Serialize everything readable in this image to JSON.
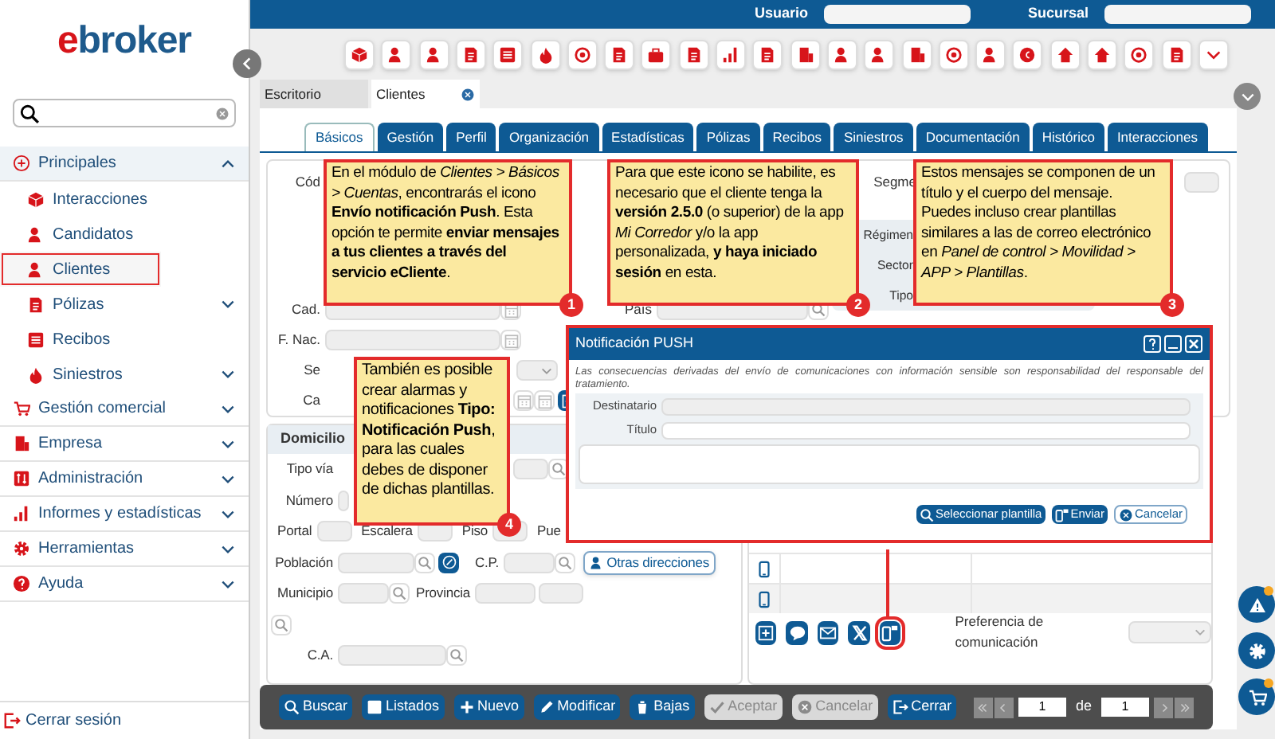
{
  "top_bar": {
    "user_label": "Usuario",
    "branch_label": "Sucursal"
  },
  "sidebar": {
    "logo": "ebroker",
    "menu": [
      {
        "label": "Principales",
        "expanded": true,
        "children": [
          {
            "label": "Interacciones",
            "selected": false
          },
          {
            "label": "Candidatos",
            "selected": false
          },
          {
            "label": "Clientes",
            "selected": true
          },
          {
            "label": "Pólizas",
            "selected": false,
            "expanded": false
          },
          {
            "label": "Recibos",
            "selected": false
          },
          {
            "label": "Siniestros",
            "selected": false,
            "expanded": false
          }
        ]
      },
      {
        "label": "Gestión comercial",
        "expanded": false
      },
      {
        "label": "Empresa",
        "expanded": false
      },
      {
        "label": "Administración",
        "expanded": false
      },
      {
        "label": "Informes y estadísticas",
        "expanded": false
      },
      {
        "label": "Herramientas",
        "expanded": false
      },
      {
        "label": "Ayuda",
        "expanded": false
      }
    ],
    "logout": "Cerrar sesión"
  },
  "document_tabs": [
    {
      "label": "Escritorio",
      "selected": false
    },
    {
      "label": "Clientes",
      "selected": true
    }
  ],
  "tabs": [
    {
      "label": "Básicos",
      "selected": true
    },
    {
      "label": "Gestión",
      "selected": false
    },
    {
      "label": "Perfil",
      "selected": false
    },
    {
      "label": "Organización",
      "selected": false
    },
    {
      "label": "Estadísticas",
      "selected": false
    },
    {
      "label": "Pólizas",
      "selected": false
    },
    {
      "label": "Recibos",
      "selected": false
    },
    {
      "label": "Siniestros",
      "selected": false
    },
    {
      "label": "Documentación",
      "selected": false
    },
    {
      "label": "Histórico",
      "selected": false
    },
    {
      "label": "Interacciones",
      "selected": false
    }
  ],
  "client_form": {
    "left_rows": [
      {
        "label": "Cód",
        "kind": "text"
      },
      {
        "label": "Cad.",
        "kind": "date"
      },
      {
        "label": "F. Nac.",
        "kind": "date"
      },
      {
        "label": "Se",
        "kind": "select"
      },
      {
        "label": "Ca",
        "kind": "date_add"
      }
    ],
    "middle_rows": [
      {
        "label": "País",
        "kind": "search"
      }
    ],
    "segment_label": "Segme",
    "panel_rows": [
      {
        "label": "Régimen"
      },
      {
        "label": "Sector"
      },
      {
        "label": "Tipo"
      }
    ]
  },
  "address": {
    "title": "Domicilio",
    "rows": [
      [
        {
          "label": "Tipo vía",
          "kind": "search_far"
        }
      ],
      [
        {
          "label": "Número",
          "kind": "stub"
        }
      ],
      [
        {
          "label": "Portal",
          "kind": "short"
        },
        {
          "label": "Escalera",
          "kind": "short"
        },
        {
          "label": "Piso",
          "kind": "short"
        },
        {
          "label": "Pue",
          "kind": "none"
        }
      ],
      [
        {
          "label": "Población",
          "kind": "locate"
        },
        {
          "label": "C.P.",
          "kind": "search_small"
        }
      ],
      [
        {
          "label": "Municipio",
          "kind": "search_small"
        },
        {
          "label": "Provincia",
          "kind": "pair"
        }
      ],
      [
        {
          "kind": "search_only"
        }
      ],
      [
        {
          "label": "C.A.",
          "kind": "search_mid"
        }
      ]
    ],
    "other_button": "Otras direcciones"
  },
  "contacts": {
    "preference_label": "Preferencia de comunicación"
  },
  "dialog": {
    "title": "Notificación PUSH",
    "notice": "Las consecuencias derivadas del envío de comunicaciones con información sensible son responsabilidad del responsable del tratamiento.",
    "recipient_label": "Destinatario",
    "title_label": "Título",
    "buttons": [
      {
        "label": "Seleccionar plantilla",
        "kind": "template"
      },
      {
        "label": "Enviar",
        "kind": "send"
      },
      {
        "label": "Cancelar",
        "kind": "cancel"
      }
    ]
  },
  "bottom_bar": {
    "buttons": [
      {
        "label": "Buscar",
        "disabled": false
      },
      {
        "label": "Listados",
        "disabled": false
      },
      {
        "label": "Nuevo",
        "disabled": false
      },
      {
        "label": "Modificar",
        "disabled": false
      },
      {
        "label": "Bajas",
        "disabled": false
      },
      {
        "label": "Aceptar",
        "disabled": true
      },
      {
        "label": "Cancelar",
        "disabled": true
      },
      {
        "label": "Cerrar",
        "disabled": false
      }
    ],
    "page": "1",
    "of_label": "de",
    "total": "1"
  },
  "callouts": [
    {
      "number": "1",
      "text": "En el módulo de *Clientes > Básicos > Cuentas*, encontrarás el icono **Envío notificación Push**. Esta opción te permite **enviar mensajes a tus clientes a través del servicio eCliente**."
    },
    {
      "number": "2",
      "text": "Para que este icono se habilite, es necesario que el cliente tenga la **versión 2.5.0** (o superior) de la app *Mi Corredor* y/o la app personalizada, **y haya iniciado sesión** en esta."
    },
    {
      "number": "3",
      "text": "Estos mensajes se componen de un título y el cuerpo del mensaje. Puedes incluso crear plantillas similares a las de correo electrónico en *Panel de control > Movilidad > APP > Plantillas*."
    },
    {
      "number": "4",
      "text": "También es posible crear alarmas y notificaciones **Tipo: Notificación Push**, para las cuales debes de disponer de dichas plantillas."
    }
  ]
}
